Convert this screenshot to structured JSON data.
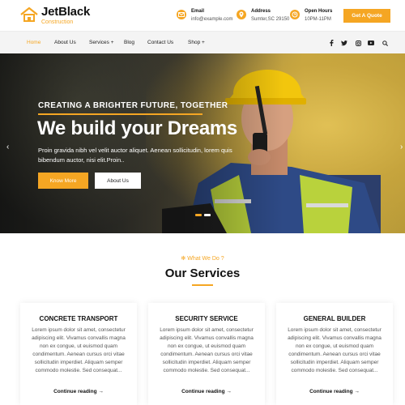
{
  "brand": {
    "name": "JetBlack",
    "tagline": "Construction",
    "accent": "#f5a623"
  },
  "header": {
    "email": {
      "icon": "mail-icon",
      "title": "Email",
      "value": "info@example.com"
    },
    "address": {
      "icon": "location-pin-icon",
      "title": "Address",
      "value": "Sumter,SC 29150"
    },
    "hours": {
      "icon": "clock-icon",
      "title": "Open Hours",
      "value": "10PM-11PM"
    },
    "quote_label": "Get A Quote"
  },
  "nav": {
    "items": [
      "Home",
      "About Us",
      "Services",
      "Blog",
      "Contact Us",
      "Shop"
    ],
    "active": "Home",
    "social_icons": [
      "facebook-icon",
      "twitter-icon",
      "instagram-icon",
      "youtube-icon",
      "search-icon"
    ]
  },
  "hero": {
    "tagline": "CREATING A BRIGHTER FUTURE, TOGETHER",
    "title": "We build your Dreams",
    "text": "Proin gravida nibh vel velit auctor aliquet. Aenean sollicitudin, lorem quis bibendum auctor, nisi elit.Proin..",
    "primary_button": "Know More",
    "secondary_button": "About Us",
    "slides": 2,
    "active_slide": 1
  },
  "services": {
    "subtitle": "What We Do ?",
    "title": "Our Services",
    "cards": [
      {
        "title": "CONCRETE TRANSPORT",
        "text": "Lorem ipsum dolor sit amet, consectetur adipiscing elit. Vivamus convallis magna non ex congue, ut euismod quam condimentum. Aenean cursus orci vitae sollicitudin imperdiet. Aliquam semper commodo molestie. Sed consequat...",
        "link": "Continue reading"
      },
      {
        "title": "SECURITY SERVICE",
        "text": "Lorem ipsum dolor sit amet, consectetur adipiscing elit. Vivamus convallis magna non ex congue, ut euismod quam condimentum. Aenean cursus orci vitae sollicitudin imperdiet. Aliquam semper commodo molestie. Sed consequat...",
        "link": "Continue reading"
      },
      {
        "title": "GENERAL BUILDER",
        "text": "Lorem ipsum dolor sit amet, consectetur adipiscing elit. Vivamus convallis magna non ex congue, ut euismod quam condimentum. Aenean cursus orci vitae sollicitudin imperdiet. Aliquam semper commodo molestie. Sed consequat...",
        "link": "Continue reading"
      }
    ]
  }
}
